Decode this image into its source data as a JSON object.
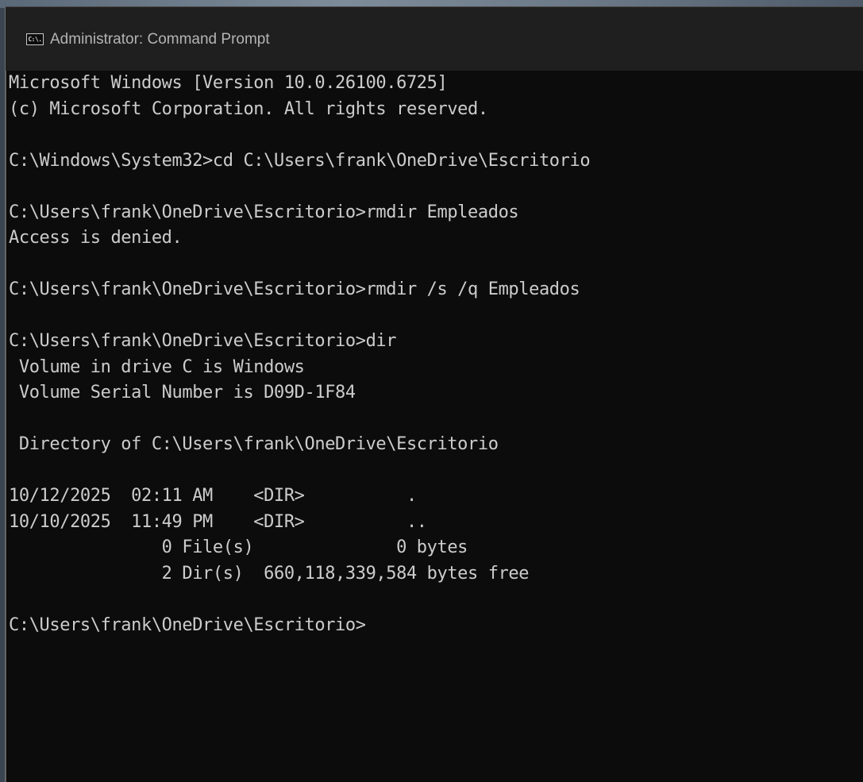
{
  "window": {
    "title": "Administrator: Command Prompt",
    "icon": "cmd-icon",
    "icon_glyph": "C:\\."
  },
  "console": {
    "lines": [
      "Microsoft Windows [Version 10.0.26100.6725]",
      "(c) Microsoft Corporation. All rights reserved.",
      "",
      "C:\\Windows\\System32>cd C:\\Users\\frank\\OneDrive\\Escritorio",
      "",
      "C:\\Users\\frank\\OneDrive\\Escritorio>rmdir Empleados",
      "Access is denied.",
      "",
      "C:\\Users\\frank\\OneDrive\\Escritorio>rmdir /s /q Empleados",
      "",
      "C:\\Users\\frank\\OneDrive\\Escritorio>dir",
      " Volume in drive C is Windows",
      " Volume Serial Number is D09D-1F84",
      "",
      " Directory of C:\\Users\\frank\\OneDrive\\Escritorio",
      "",
      "10/12/2025  02:11 AM    <DIR>          .",
      "10/10/2025  11:49 PM    <DIR>          ..",
      "               0 File(s)              0 bytes",
      "               2 Dir(s)  660,118,339,584 bytes free",
      "",
      "C:\\Users\\frank\\OneDrive\\Escritorio>"
    ]
  },
  "colors": {
    "console_background": "#0c0c0c",
    "console_text": "#cccccc",
    "titlebar_background": "#1f1f1f",
    "titlebar_text": "#b4b4b4"
  }
}
